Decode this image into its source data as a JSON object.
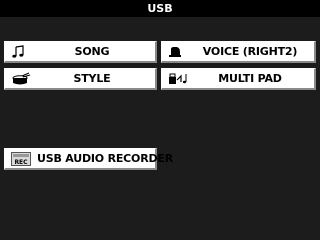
{
  "header": {
    "title": "USB"
  },
  "menu": {
    "song": {
      "label": "SONG",
      "icon": "music-note-icon"
    },
    "voice": {
      "label": "VOICE (RIGHT2)",
      "icon": "piano-icon"
    },
    "style": {
      "label": "STYLE",
      "icon": "drum-icon"
    },
    "multi_pad": {
      "label": "MULTI PAD",
      "icon": "instruments-icon"
    },
    "usb_audio_recorder": {
      "label": "USB AUDIO RECORDER",
      "icon": "rec-icon",
      "icon_text": "REC"
    }
  }
}
